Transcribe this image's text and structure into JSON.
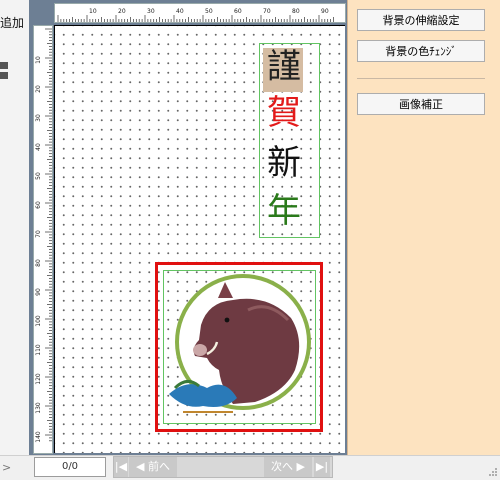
{
  "left_panel": {
    "add_label": "追加",
    "expand_glyph": ">"
  },
  "ruler": {
    "top_ticks": [
      "10",
      "20",
      "30",
      "40",
      "50",
      "60",
      "70",
      "80",
      "90"
    ],
    "left_ticks": [
      "10",
      "20",
      "30",
      "40",
      "50",
      "60",
      "70",
      "80",
      "90",
      "100",
      "110",
      "120",
      "130",
      "140"
    ]
  },
  "card": {
    "greeting_chars": [
      "謹",
      "賀",
      "新",
      "年"
    ],
    "greeting_colors": [
      "#222222",
      "#e31a1a",
      "#111111",
      "#2a7a1a"
    ]
  },
  "right_panel": {
    "bg_stretch_button": "背景の伸縮設定",
    "bg_color_button": "背景の色ﾁｪﾝｼﾞ",
    "image_correct_button": "画像補正"
  },
  "status": {
    "page_counter": "0/0",
    "prev_label": "◀ 前へ",
    "next_label": "次へ ▶",
    "first_icon": "first-page-icon",
    "last_icon": "last-page-icon"
  }
}
